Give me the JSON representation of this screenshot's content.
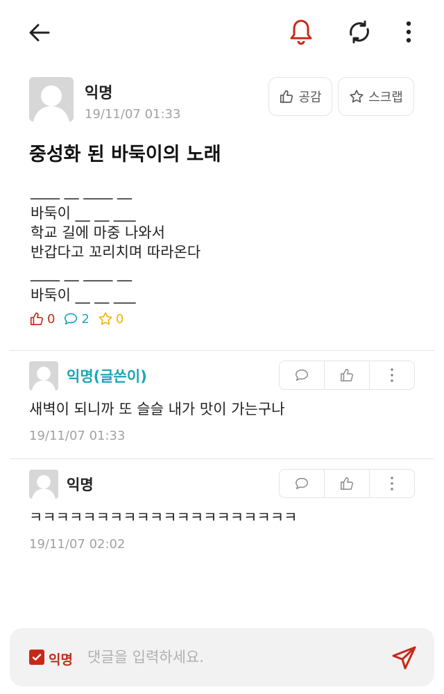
{
  "header": {
    "back_icon": "back-arrow-icon",
    "bell_icon": "bell-icon",
    "refresh_icon": "refresh-icon",
    "more_icon": "more-vertical-icon",
    "bell_color": "#c62917"
  },
  "post": {
    "author": "익명",
    "date": "19/11/07 01:33",
    "like_button_label": "공감",
    "scrap_button_label": "스크랩",
    "title": "중성화 된 바둑이의 노래",
    "body_lines": [
      "____ __ ____ __",
      "바둑이 __ __ ___",
      "학교 길에 마중 나와서",
      "반갑다고 꼬리치며 따라온다",
      "____ __ ____ __",
      "바둑이 __ __ ___"
    ],
    "stats": {
      "likes": "0",
      "comments": "2",
      "scraps": "0"
    },
    "stat_colors": {
      "likes": "#c62917",
      "comments": "#1aa5b6",
      "scraps": "#f0b400"
    }
  },
  "comments": [
    {
      "author": "익명(글쓴이)",
      "is_writer": true,
      "text": "새벽이 되니까 또 슬슬 내가 맛이 가는구나",
      "date": "19/11/07 01:33"
    },
    {
      "author": "익명",
      "is_writer": false,
      "text": "ㅋㅋㅋㅋㅋㅋㅋㅋㅋㅋㅋㅋㅋㅋㅋㅋㅋㅋㅋㅋ",
      "date": "19/11/07 02:02"
    }
  ],
  "comment_input": {
    "anonymous_label": "익명",
    "anonymous_checked": true,
    "placeholder": "댓글을 입력하세요.",
    "value": "",
    "accent": "#c62917"
  }
}
